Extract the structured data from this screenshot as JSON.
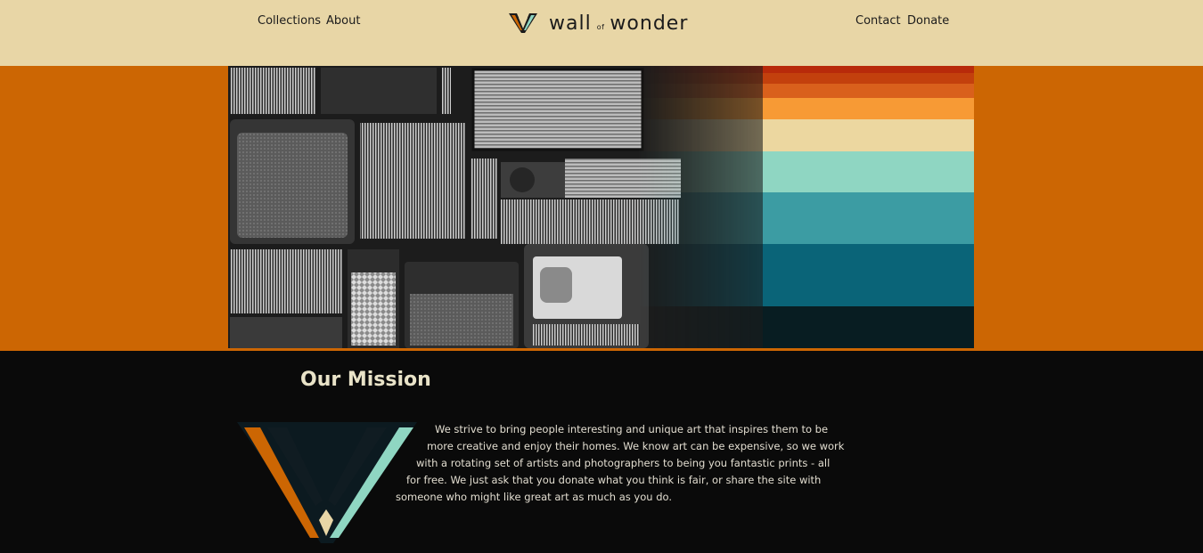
{
  "header": {
    "nav_left": [
      "Collections",
      "About"
    ],
    "nav_right": [
      "Contact",
      "Donate"
    ],
    "logo": {
      "word1": "wall",
      "small": "of",
      "word2": "wonder"
    }
  },
  "hero": {
    "stripe_colors": [
      "#b82a0a",
      "#c3400d",
      "#d9601c",
      "#f79a35",
      "#ecd7a0",
      "#8fd6c2",
      "#3c9ca3",
      "#0a6478",
      "#081d22"
    ]
  },
  "mission": {
    "title": "Our Mission",
    "lines": [
      "We strive to bring people interesting and unique art that inspires them to be",
      "more creative and enjoy their homes. We know art can be expensive, so we work",
      "with a rotating set of artists and photographers to being you fantastic prints - all",
      "for free. We just ask that you donate what you think is fair, or share the site with",
      "someone who might like great art as much as you do."
    ]
  },
  "colors": {
    "header_bg": "#e8d6a6",
    "accent_orange": "#cc6603",
    "accent_teal": "#8fd6c2",
    "body_bg": "#0a0a0a"
  }
}
